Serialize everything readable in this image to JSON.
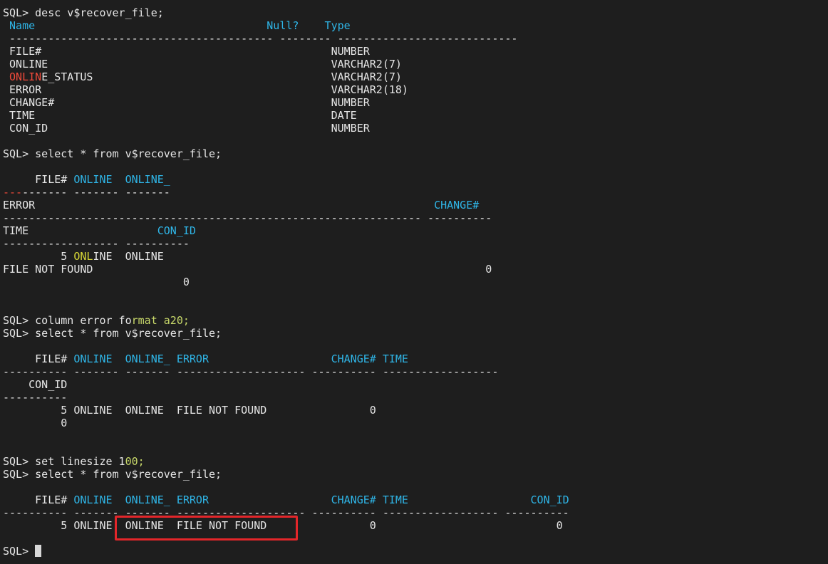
{
  "lines": [
    [
      {
        "t": "SQL> desc v$recover_file;",
        "c": "white"
      }
    ],
    [
      {
        "t": " Name                                    ",
        "c": "cyan"
      },
      {
        "t": "Null?    ",
        "c": "cyan"
      },
      {
        "t": "Type",
        "c": "cyan"
      }
    ],
    [
      {
        "t": " ----------------------------------------- -------- ----------------------------",
        "c": "white"
      }
    ],
    [
      {
        "t": " FILE#                                             NUMBER",
        "c": "white"
      }
    ],
    [
      {
        "t": " ONLINE                                            VARCHAR2(7)",
        "c": "white"
      }
    ],
    [
      {
        "t": " ",
        "c": "white"
      },
      {
        "t": "ONLIN",
        "c": "red"
      },
      {
        "t": "E_STATUS                                     VARCHAR2(7)",
        "c": "white"
      }
    ],
    [
      {
        "t": " ERROR                                             VARCHAR2(18)",
        "c": "white"
      }
    ],
    [
      {
        "t": " CHANGE#                                           NUMBER",
        "c": "white"
      }
    ],
    [
      {
        "t": " TIME                                              DATE",
        "c": "white"
      }
    ],
    [
      {
        "t": " CON_ID                                            NUMBER",
        "c": "white"
      }
    ],
    [],
    [
      {
        "t": "SQL> select * from v$recover_file;",
        "c": "white"
      }
    ],
    [],
    [
      {
        "t": "     FILE# ",
        "c": "white"
      },
      {
        "t": "ONLINE  ONLINE_",
        "c": "cyan"
      }
    ],
    [
      {
        "t": "---",
        "c": "red"
      },
      {
        "t": "------- ------- -------",
        "c": "white"
      }
    ],
    [
      {
        "t": "ERROR                                                              ",
        "c": "white"
      },
      {
        "t": "CHANGE#",
        "c": "cyan"
      }
    ],
    [
      {
        "t": "----------------------------------------------------------------- ----------",
        "c": "white"
      }
    ],
    [
      {
        "t": "TIME                    ",
        "c": "white"
      },
      {
        "t": "CON_ID",
        "c": "cyan"
      }
    ],
    [
      {
        "t": "------------------ ----------",
        "c": "white"
      }
    ],
    [
      {
        "t": "         5 ",
        "c": "white"
      },
      {
        "t": "ONL",
        "c": "yellow"
      },
      {
        "t": "INE  ONLINE",
        "c": "white"
      }
    ],
    [
      {
        "t": "FILE NOT FOUND                                                             0",
        "c": "white"
      }
    ],
    [
      {
        "t": "                            0",
        "c": "white"
      }
    ],
    [],
    [],
    [
      {
        "t": "SQL> column error fo",
        "c": "white"
      },
      {
        "t": "rmat a20;",
        "c": "lgreen"
      }
    ],
    [
      {
        "t": "SQL> select * from v$recover_file;",
        "c": "white"
      }
    ],
    [],
    [
      {
        "t": "     FILE# ",
        "c": "white"
      },
      {
        "t": "ONLINE  ONLINE_ ERROR                   CHANGE# TIME",
        "c": "cyan"
      }
    ],
    [
      {
        "t": "---------- ------- ------- -------------------- ---------- ------------------",
        "c": "white"
      }
    ],
    [
      {
        "t": "    CON_ID",
        "c": "white"
      }
    ],
    [
      {
        "t": "----------",
        "c": "white"
      }
    ],
    [
      {
        "t": "         5 ONLINE  ONLINE  FILE NOT FOUND                0",
        "c": "white"
      }
    ],
    [
      {
        "t": "         0",
        "c": "white"
      }
    ],
    [],
    [],
    [
      {
        "t": "SQL> set linesize 1",
        "c": "white"
      },
      {
        "t": "00;",
        "c": "lgreen"
      }
    ],
    [
      {
        "t": "SQL> select * from v$recover_file;",
        "c": "white"
      }
    ],
    [],
    [
      {
        "t": "     FILE# ",
        "c": "white"
      },
      {
        "t": "ONLINE  ONLINE_ ERROR                   CHANGE# TIME                   CON_ID",
        "c": "cyan"
      }
    ],
    [
      {
        "t": "---------- ------- ------- -------------------- ---------- ------------------ ----------",
        "c": "white"
      }
    ],
    [
      {
        "t": "         5 ONLINE  ONLINE  FILE NOT FOUND                0                            0",
        "c": "white"
      }
    ],
    []
  ],
  "prompt": "SQL> "
}
